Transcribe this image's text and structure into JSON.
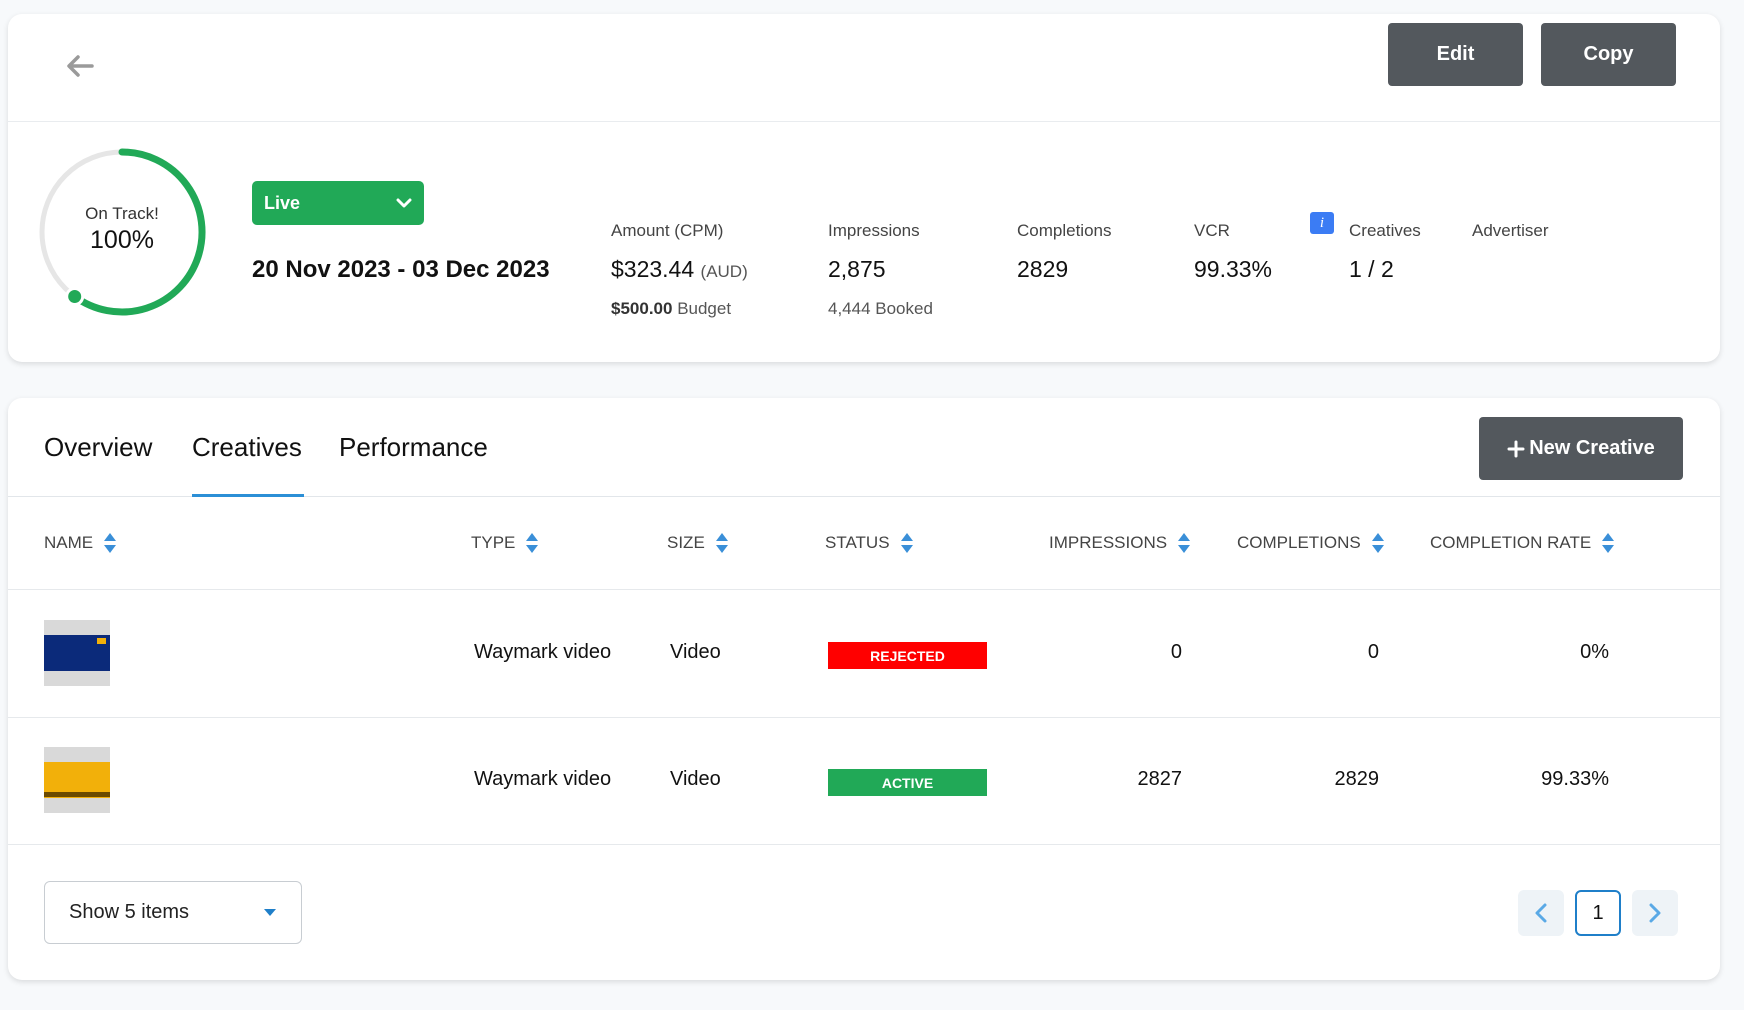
{
  "header": {
    "edit_label": "Edit",
    "copy_label": "Copy"
  },
  "summary": {
    "progress": {
      "status_text": "On Track!",
      "percent_text": "100%",
      "percent_value": 100,
      "color": "#21a957"
    },
    "status_dropdown": {
      "value": "Live",
      "color": "#21a957"
    },
    "dates": "20 Nov 2023 - 03 Dec 2023",
    "metrics": {
      "amount": {
        "label": "Amount (CPM)",
        "value": "$323.44",
        "unit": "(AUD)",
        "budget_value": "$500.00",
        "budget_label": "Budget"
      },
      "impressions": {
        "label": "Impressions",
        "value": "2,875",
        "sub": "4,444 Booked"
      },
      "completions": {
        "label": "Completions",
        "value": "2829"
      },
      "vcr": {
        "label": "VCR",
        "value": "99.33%"
      },
      "creatives": {
        "label": "Creatives",
        "value": "1 / 2",
        "info_icon": "i"
      },
      "advertiser": {
        "label": "Advertiser",
        "value": ""
      }
    }
  },
  "tabs": [
    {
      "label": "Overview"
    },
    {
      "label": "Creatives",
      "active": true
    },
    {
      "label": "Performance"
    }
  ],
  "new_creative_label": "New Creative",
  "table": {
    "columns": [
      "NAME",
      "TYPE",
      "SIZE",
      "STATUS",
      "IMPRESSIONS",
      "COMPLETIONS",
      "COMPLETION RATE"
    ],
    "rows": [
      {
        "type": "Waymark video",
        "size": "Video",
        "status": "REJECTED",
        "status_color": "#ff0000",
        "impressions": "0",
        "completions": "0",
        "completion_rate": "0%",
        "thumb_color": "#0b2a7a"
      },
      {
        "type": "Waymark video",
        "size": "Video",
        "status": "ACTIVE",
        "status_color": "#21a957",
        "impressions": "2827",
        "completions": "2829",
        "completion_rate": "99.33%",
        "thumb_color": "#f2b00a"
      }
    ]
  },
  "pagination": {
    "page_size_label": "Show 5 items",
    "current_page": "1"
  },
  "icons": {
    "back": "arrow-left-icon",
    "sort": "sort-icon",
    "dropdown": "chevron-down-icon",
    "plus": "plus-icon",
    "prev": "chevron-left-icon",
    "next": "chevron-right-icon"
  }
}
